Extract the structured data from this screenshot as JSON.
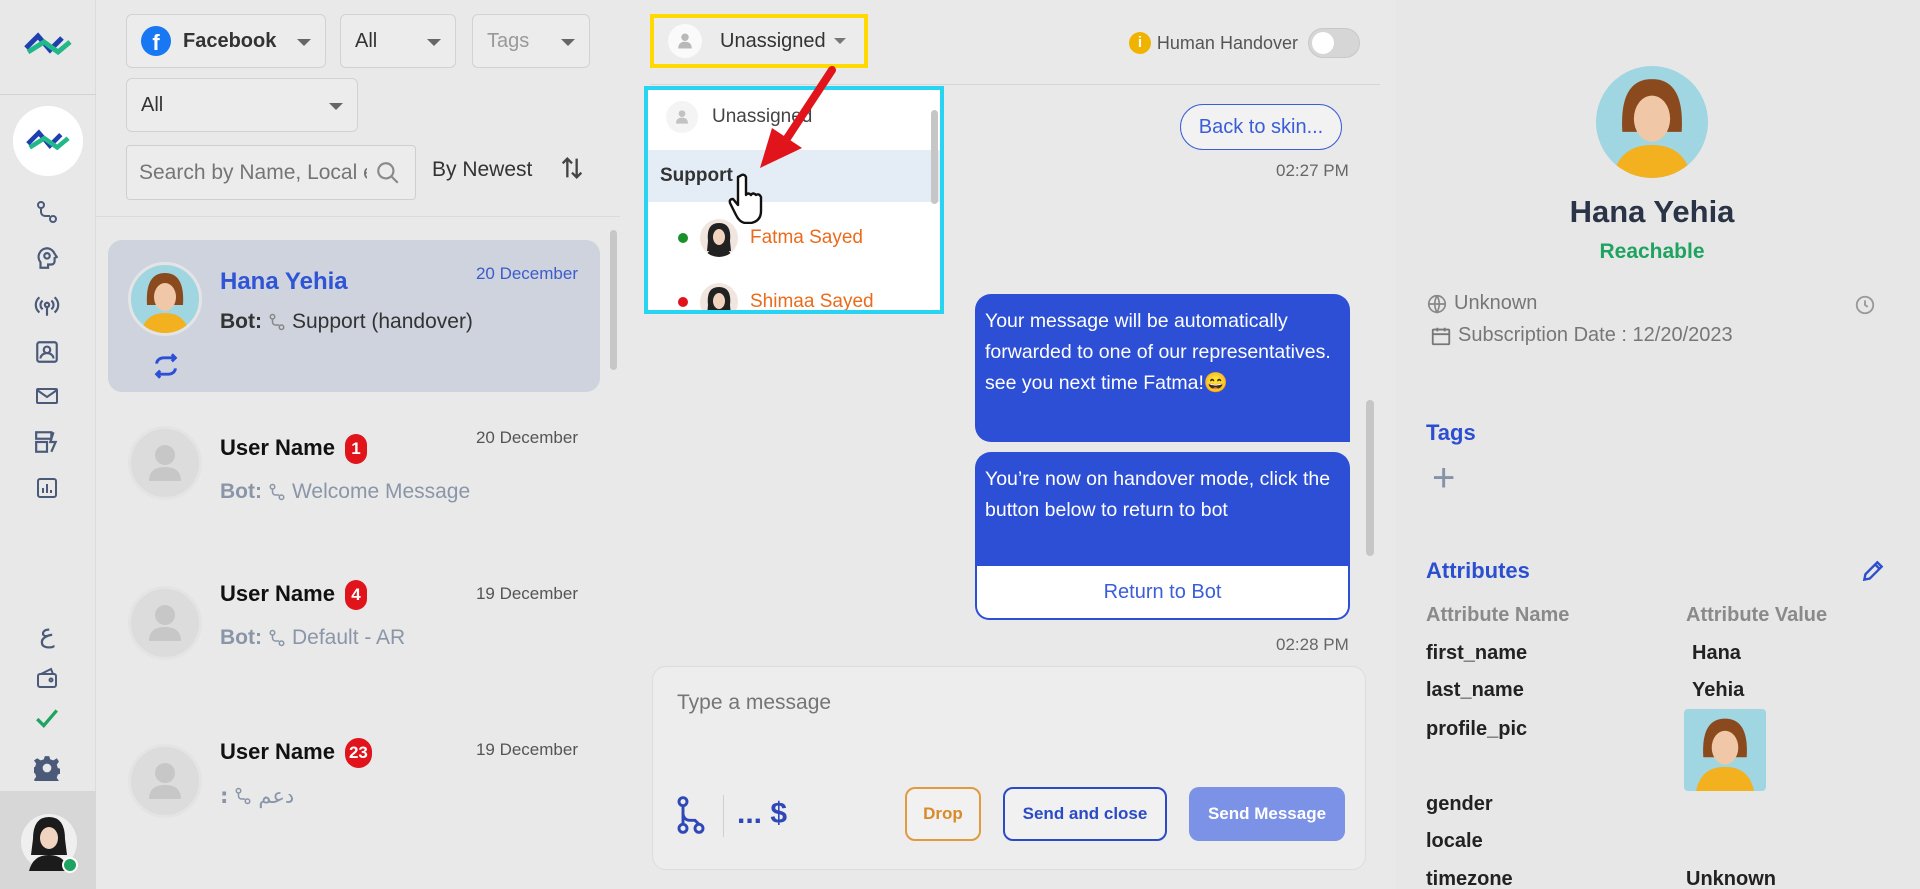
{
  "rail": {
    "icons": [
      "logo-icon",
      "brand-logo-icon",
      "flow-icon",
      "brain-icon",
      "broadcast-icon",
      "contacts-icon",
      "mail-icon",
      "automation-icon",
      "analytics-icon",
      "arabic-language-icon",
      "wallet-icon",
      "check-icon",
      "settings-icon",
      "agent-avatar"
    ]
  },
  "filters": {
    "channel": "Facebook",
    "status": "All",
    "tags_placeholder": "Tags",
    "assignment": "All"
  },
  "search": {
    "placeholder": "Search by Name, Local e"
  },
  "sort": {
    "label": "By Newest"
  },
  "conversations": [
    {
      "name": "Hana Yehia",
      "date": "20 December",
      "bot_label": "Bot:",
      "flow": "Support (handover)",
      "active": true
    },
    {
      "name": "User Name",
      "date": "20 December",
      "badge": "1",
      "bot_label": "Bot:",
      "flow": "Welcome Message"
    },
    {
      "name": "User Name",
      "date": "19 December",
      "badge": "4",
      "bot_label": "Bot:",
      "flow": "Default - AR"
    },
    {
      "name": "User Name",
      "date": "19 December",
      "badge": "23",
      "bot_label": ":",
      "flow": "دعم"
    }
  ],
  "chat": {
    "assign_label": "Unassigned",
    "handover_label": "Human Handover",
    "dropdown": {
      "unassigned": "Unassigned",
      "group": "Support",
      "agents": [
        {
          "name": "Fatma Sayed",
          "status_color": "#1a8f2a"
        },
        {
          "name": "Shimaa Sayed",
          "status_color": "#e0141a"
        }
      ]
    },
    "back_button": "Back to skin...",
    "time_1": "02:27 PM",
    "message_1": "Your message will be automatically forwarded to one of our representatives. see you next time Fatma!😄",
    "message_2": "You’re now on handover mode, click the button below to return to bot",
    "return_button": "Return to Bot",
    "time_2": "02:28 PM",
    "composer_placeholder": "Type a message",
    "vars_label": "... $",
    "drop_button": "Drop",
    "send_close_button": "Send and close",
    "send_button": "Send Message"
  },
  "profile": {
    "name": "Hana Yehia",
    "status": "Reachable",
    "location": "Unknown",
    "subscription": "Subscription Date : 12/20/2023",
    "tags_title": "Tags",
    "attributes_title": "Attributes",
    "attr_name_header": "Attribute Name",
    "attr_value_header": "Attribute Value",
    "attributes": [
      {
        "key": "first_name",
        "value": "Hana"
      },
      {
        "key": "last_name",
        "value": "Yehia"
      },
      {
        "key": "profile_pic",
        "value": ""
      },
      {
        "key": "gender",
        "value": ""
      },
      {
        "key": "locale",
        "value": ""
      },
      {
        "key": "timezone",
        "value": "Unknown"
      }
    ]
  },
  "colors": {
    "accent": "#2d4fd6",
    "highlight_yellow": "#ffd900",
    "highlight_cyan": "#29d4f3",
    "arrow_red": "#e0141a",
    "reachable_green": "#1fa360"
  }
}
